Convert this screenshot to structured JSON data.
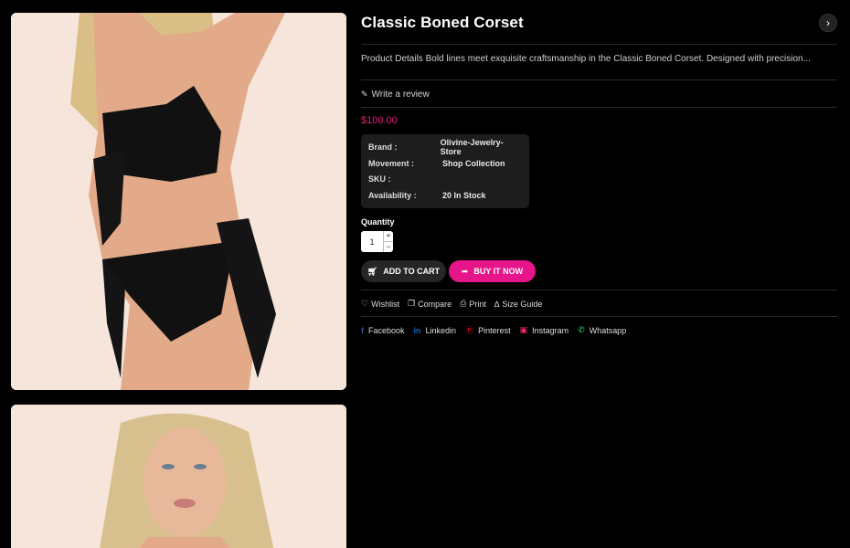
{
  "product": {
    "title": "Classic Boned Corset",
    "description": "Product Details Bold lines meet exquisite craftsmanship in the Classic Boned Corset. Designed with precision...",
    "review_label": "Write a review",
    "price": "$100.00",
    "price_color": "#e0207a",
    "next_icon": "chevron-right-icon"
  },
  "specs": [
    {
      "label": "Brand :",
      "value": "Olivine-Jewelry-Store"
    },
    {
      "label": "Movement :",
      "value": "Shop Collection"
    },
    {
      "label": "SKU :",
      "value": ""
    },
    {
      "label": "Availability :",
      "value": "20 In Stock"
    }
  ],
  "quantity": {
    "label": "Quantity",
    "value": "1",
    "plus": "+",
    "minus": "−"
  },
  "buttons": {
    "add_to_cart": "ADD TO CART",
    "buy_now": "BUY IT NOW",
    "buy_color": "#e6168a"
  },
  "utilities": {
    "wishlist": "Wishlist",
    "compare": "Compare",
    "print": "Print",
    "size_guide": "Size Guide"
  },
  "social": {
    "facebook": "Facebook",
    "linkedin": "Linkedin",
    "pinterest": "Pinterest",
    "instagram": "Instagram",
    "whatsapp": "Whatsapp"
  }
}
